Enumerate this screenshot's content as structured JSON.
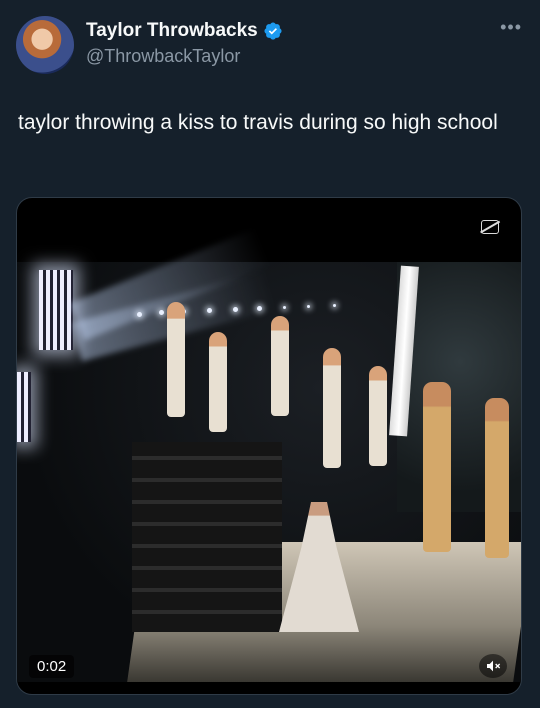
{
  "author": {
    "display_name": "Taylor Throwbacks",
    "handle": "@ThrowbackTaylor",
    "verified": true,
    "verified_color": "#1d9bf0"
  },
  "tweet": {
    "text": "taylor throwing a kiss to travis during so high school"
  },
  "media": {
    "type": "video",
    "elapsed": "0:02",
    "icons": [
      "captions-off-icon",
      "muted-speaker-icon"
    ]
  },
  "colors": {
    "background": "#15202b",
    "secondary_text": "#8b98a5",
    "primary_text": "#f7f9f9"
  }
}
